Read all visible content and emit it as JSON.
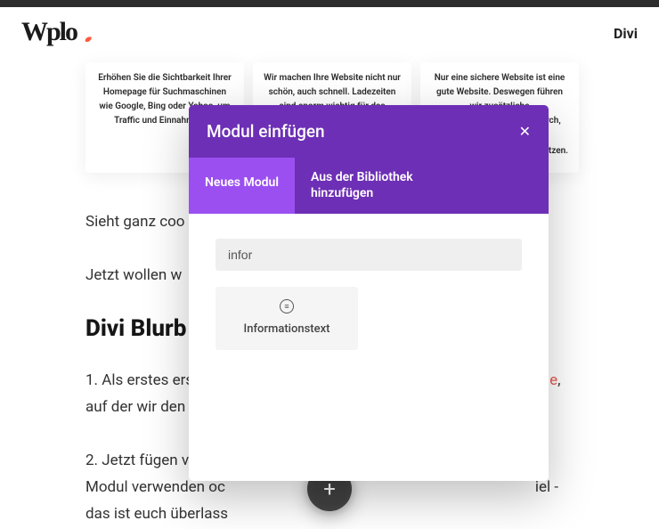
{
  "header": {
    "nav_divi": "Divi"
  },
  "cards": {
    "c1": "Erhöhen Sie die Sichtbarkeit Ihrer Homepage für Suchmaschinen wie Google, Bing oder Yahoo, um Traffic und Einnahmen zu",
    "c2": "Wir machen Ihre Website nicht nur schön, auch schnell. Ladezeiten sind enorm wichtig für das Nutzererlebnis Ihrer",
    "c3": "Nur eine sichere Website ist eine gute Website. Deswegen führen wir zusätzliche Sicherheitsmaßnahmen durch, um Ihre",
    "c3_suffix": "hützen."
  },
  "article": {
    "p1": "Sieht ganz coo",
    "p2": "Jetzt wollen w",
    "h2": "Divi Blurb M",
    "p3_a": "1. Als erstes ers",
    "p3_link": "e",
    "p3_b": ", auf der wir den Effekt eins",
    "p4_a": "2. Jetzt fügen v",
    "p4_b": "n Modul verwenden oc",
    "p4_c": "iel - das ist euch überlass"
  },
  "modal": {
    "title": "Modul einfügen",
    "tab_new": "Neues Modul",
    "tab_library": "Aus der Bibliothek hinzufügen",
    "search_value": "infor",
    "module_label": "Informationstext",
    "module_icon_glyph": "≡"
  },
  "icons": {
    "close": "✕",
    "plus": "+"
  }
}
